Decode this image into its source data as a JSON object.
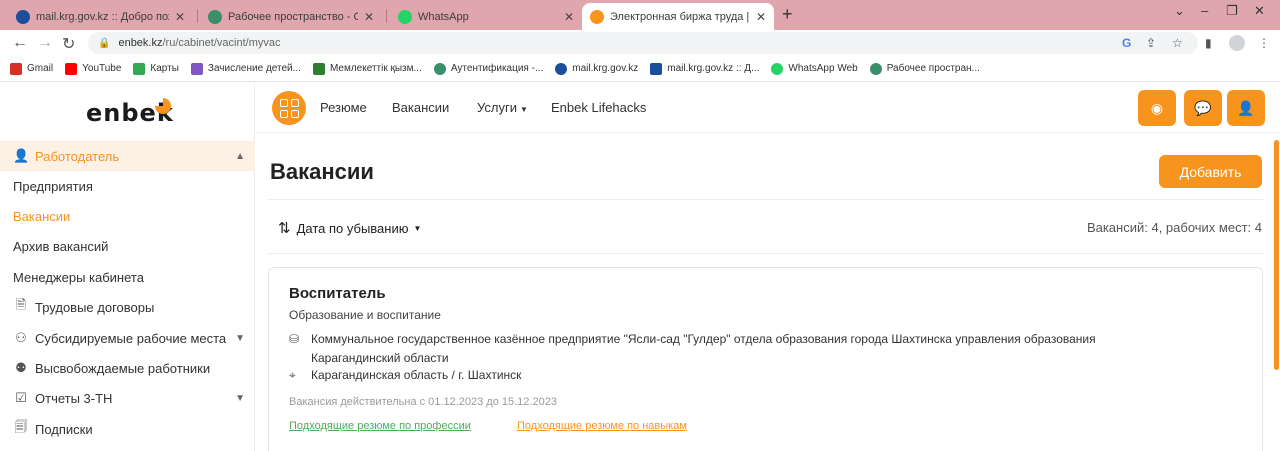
{
  "browser": {
    "tabs": [
      {
        "title": "mail.krg.gov.kz :: Добро пожалова",
        "fav_color": "#1b4f9c"
      },
      {
        "title": "Рабочее пространство - Отдел",
        "fav_color": "#3a8f6a"
      },
      {
        "title": "WhatsApp",
        "fav_color": "#25d366"
      },
      {
        "title": "Электронная биржа труда | Вак",
        "fav_color": "#f7941d"
      }
    ],
    "new_tab": "+",
    "url_domain": "enbek.kz",
    "url_path": "/ru/cabinet/vacint/myvac"
  },
  "bookmarks": [
    {
      "label": "Gmail",
      "color": "#d93025"
    },
    {
      "label": "YouTube",
      "color": "#ff0000"
    },
    {
      "label": "Карты",
      "color": "#34a853"
    },
    {
      "label": "Зачисление детей...",
      "color": "#7e57c2"
    },
    {
      "label": "Мемлекеттік қызм...",
      "color": "#2e7d32"
    },
    {
      "label": "Аутентификация -...",
      "color": "#3a8f6a"
    },
    {
      "label": "mail.krg.gov.kz",
      "color": "#1b4f9c"
    },
    {
      "label": "mail.krg.gov.kz :: Д...",
      "color": "#1b4f9c"
    },
    {
      "label": "WhatsApp Web",
      "color": "#25d366"
    },
    {
      "label": "Рабочее простран...",
      "color": "#3a8f6a"
    }
  ],
  "sidebar": {
    "logo": "enbek",
    "items": [
      {
        "label": "Работодатель"
      },
      {
        "label": "Предприятия"
      },
      {
        "label": "Вакансии"
      },
      {
        "label": "Архив вакансий"
      },
      {
        "label": "Менеджеры кабинета"
      },
      {
        "label": "Трудовые договоры"
      },
      {
        "label": "Субсидируемые рабочие места"
      },
      {
        "label": "Высвобождаемые работники"
      },
      {
        "label": "Отчеты 3-ТН"
      },
      {
        "label": "Подписки"
      }
    ]
  },
  "header": {
    "nav": [
      "Резюме",
      "Вакансии",
      "Услуги",
      "Enbek Lifehacks"
    ]
  },
  "main": {
    "title": "Вакансии",
    "add_label": "Добавить",
    "sort_label": "Дата по убыванию",
    "count_text": "Вакансий: 4, рабочих мест: 4",
    "vacancy": {
      "title": "Воспитатель",
      "sphere": "Образование и воспитание",
      "org_line1": "Коммунальное государственное казённое предприятие \"Ясли-сад \"Гулдер\" отдела образования города Шахтинска управления образования",
      "org_line2": "Карагандинский области",
      "location": "Карагандинская область / г. Шахтинск",
      "validity": "Вакансия действительна с 01.12.2023 до 15.12.2023",
      "link_profession": "Подходящие резюме по профессии",
      "link_skills": "Подходящие резюме по навыкам"
    }
  },
  "colors": {
    "accent": "#f7941d",
    "tabstrip": "#dfa6ad",
    "green_link": "#4caf50"
  }
}
